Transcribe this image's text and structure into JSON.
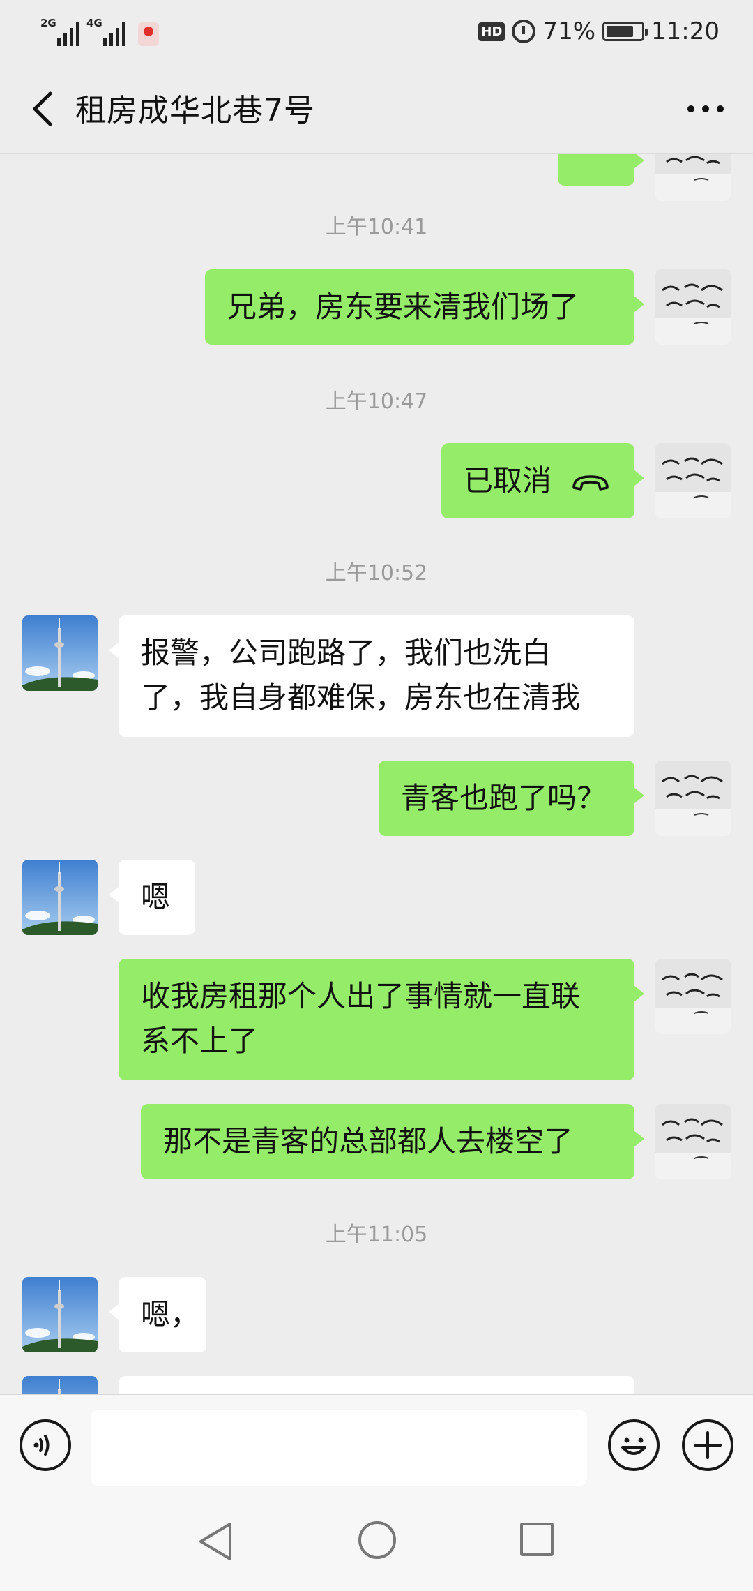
{
  "status_bar": {
    "net1": "2G",
    "net2": "4G",
    "hd": "HD",
    "battery": "71%",
    "time": "11:20"
  },
  "header": {
    "title": "租房成华北巷7号"
  },
  "messages": [
    {
      "type": "partial_out"
    },
    {
      "type": "time",
      "text": "上午10:41"
    },
    {
      "type": "out",
      "text": "兄弟，房东要来清我们场了"
    },
    {
      "type": "time",
      "text": "上午10:47"
    },
    {
      "type": "out_call",
      "text": "已取消"
    },
    {
      "type": "time",
      "text": "上午10:52"
    },
    {
      "type": "in",
      "text": "报警，公司跑路了，我们也洗白\n了，我自身都难保，房东也在清我"
    },
    {
      "type": "out",
      "text": "青客也跑了吗？"
    },
    {
      "type": "in",
      "text": "嗯"
    },
    {
      "type": "out",
      "text": "收我房租那个人出了事情就一直联\n系不上了"
    },
    {
      "type": "out",
      "text": "那不是青客的总部都人去楼空了"
    },
    {
      "type": "time",
      "text": "上午11:05"
    },
    {
      "type": "in",
      "text": "嗯，"
    },
    {
      "type": "partial_in"
    }
  ],
  "input": {
    "value": "",
    "placeholder": ""
  },
  "icons": {
    "back": "back-arrow-icon",
    "more": "more-dots-icon",
    "voice": "voice-icon",
    "emoji": "emoji-icon",
    "plus": "plus-icon",
    "call": "hangup-call-icon"
  },
  "colors": {
    "background": "#ededed",
    "outgoing_bubble": "#95ec69",
    "incoming_bubble": "#ffffff",
    "timestamp": "#9a9a9a"
  }
}
